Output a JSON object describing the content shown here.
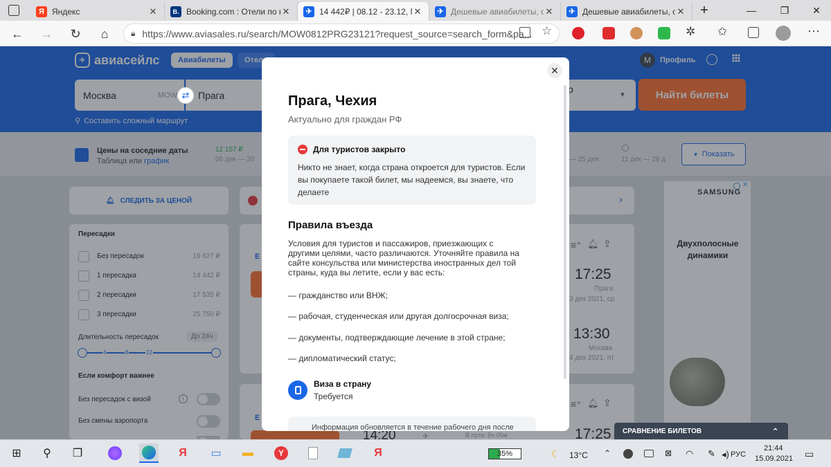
{
  "browser": {
    "tabs": [
      {
        "title": "Яндекс",
        "favicon": "yandex-icon",
        "color": "#fc3f1d",
        "glyph": "Я"
      },
      {
        "title": "Booking.com : Отели по н",
        "favicon": "booking-icon",
        "color": "#003580",
        "glyph": "B."
      },
      {
        "title": "14 442₽ | 08.12 - 23.12, М",
        "favicon": "aviasales-icon",
        "color": "#1a67e8",
        "glyph": "✈"
      },
      {
        "title": "Дешевые авиабилеты, от",
        "favicon": "aviasales-icon",
        "color": "#1a67e8",
        "glyph": "✈"
      },
      {
        "title": "Дешевые авиабилеты, от",
        "favicon": "aviasales-icon",
        "color": "#1a67e8",
        "glyph": "✈"
      }
    ],
    "new_tab": "+",
    "url": "https://www.aviasales.ru/search/MOW0812PRG23121?request_source=search_form&pa..."
  },
  "site": {
    "logo": "авиасейлс",
    "nav": {
      "flights": "Авиабилеты",
      "hotels": "Отели"
    },
    "profile_initial": "M",
    "profile_label": "Профиль",
    "search": {
      "from": "Москва",
      "from_code": "MOW",
      "to": "Прага",
      "passengers_partial": "р",
      "find_button": "Найти билеты"
    },
    "complex_route": "Составить сложный маршрут"
  },
  "subbar": {
    "neighbor_title": "Цены на соседние даты",
    "table_link": "Таблица",
    "or": "или",
    "chart_link": "график",
    "price1": "12 157 ₽",
    "dates1": "06 дек — 20",
    "dates2": "— 25 дек",
    "dates3": "11 дек — 26 д",
    "show_button": "Показать"
  },
  "sidebar": {
    "track_price": "СЛЕДИТЬ ЗА ЦЕНОЙ",
    "stops_title": "Пересадки",
    "stops": [
      {
        "label": "Без пересадок",
        "price": "19 627 ₽"
      },
      {
        "label": "1 пересадка",
        "price": "14 442 ₽"
      },
      {
        "label": "2 пересадки",
        "price": "17 535 ₽"
      },
      {
        "label": "3 пересадки",
        "price": "25 750 ₽"
      }
    ],
    "duration_title": "Длительность пересадок",
    "duration_value": "До 24ч",
    "duration_ticks": [
      "4",
      "8",
      "12"
    ],
    "comfort_title": "Если комфорт важнее",
    "comfort": [
      {
        "label": "Без пересадок с визой"
      },
      {
        "label": "Без смены аэропорта"
      }
    ]
  },
  "results": {
    "t1": "17:25",
    "c1": "Прага",
    "d1": "3 дек 2021, ср",
    "t2": "13:30",
    "c2": "Москва",
    "d2": "4 дек 2021, пт",
    "t3": "14:20",
    "inway": "В пути: 5ч 05м",
    "t4": "17:25",
    "ticket_tag": "Е"
  },
  "ad": {
    "brand": "SAMSUNG",
    "text": "Двухполосные динамики"
  },
  "modal": {
    "title": "Прага, Чехия",
    "subtitle": "Актуально для граждан РФ",
    "alert_title": "Для туристов закрыто",
    "alert_body": "Никто не знает, когда страна откроется для туристов. Если вы покупаете такой билет, мы надеемся, вы знаете, что делаете",
    "rules_title": "Правила въезда",
    "rules_text": "Условия для туристов и пассажиров, приезжающих с другими целями, часто различаются. Уточняйте правила на сайте консульства или министерства иностранных дел той страны, куда вы летите, если у вас есть:",
    "rules_items": [
      "— гражданство или ВНЖ;",
      "— рабочая, студенческая или другая долгосрочная виза;",
      "— документы, подтверждающие лечение в этой стране;",
      "— дипломатический статус;"
    ],
    "visa_title": "Виза в страну",
    "visa_value": "Требуется",
    "info_text": "Информация обновляется в течение рабочего дня после"
  },
  "compare_bar": "СРАВНЕНИЕ БИЛЕТОВ",
  "taskbar": {
    "battery": "35%",
    "weather": "13°C",
    "lang": "РУС",
    "time": "21:44",
    "date": "15.09.2021"
  }
}
